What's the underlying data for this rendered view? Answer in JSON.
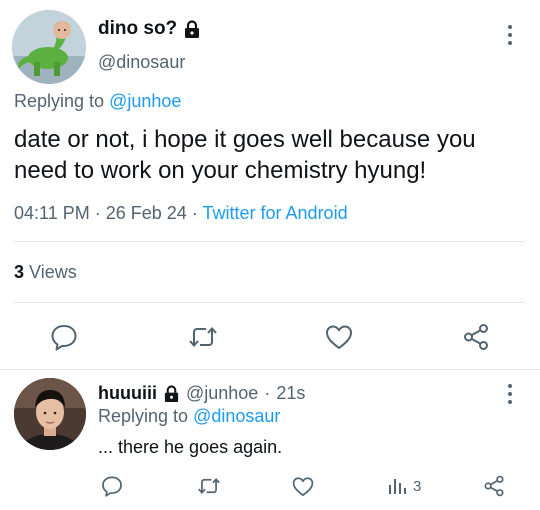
{
  "main_tweet": {
    "display_name": "dino so?",
    "handle": "@dinosaur",
    "replying_prefix": "Replying to",
    "replying_handle": "@junhoe",
    "text": "date or not, i hope it goes well because you need to work on your chemistry hyung!",
    "time": "04:11 PM",
    "sep1": "·",
    "date": "26 Feb 24",
    "sep2": "·",
    "source": "Twitter for Android",
    "views_count": "3",
    "views_label": "Views"
  },
  "reply_tweet": {
    "display_name": "huuuiii",
    "handle": "@junhoe",
    "sep": "·",
    "age": "21s",
    "replying_prefix": "Replying to",
    "replying_handle": "@dinosaur",
    "text": "... there he goes again.",
    "views_count": "3"
  },
  "icons": {
    "lock": "lock-icon",
    "more": "more-vertical-icon",
    "reply": "reply-icon",
    "retweet": "retweet-icon",
    "like": "heart-icon",
    "share": "share-icon",
    "views": "views-icon"
  },
  "colors": {
    "text": "#0f1419",
    "muted": "#536471",
    "link": "#1d9bf0",
    "divider": "#e1e6ea"
  }
}
